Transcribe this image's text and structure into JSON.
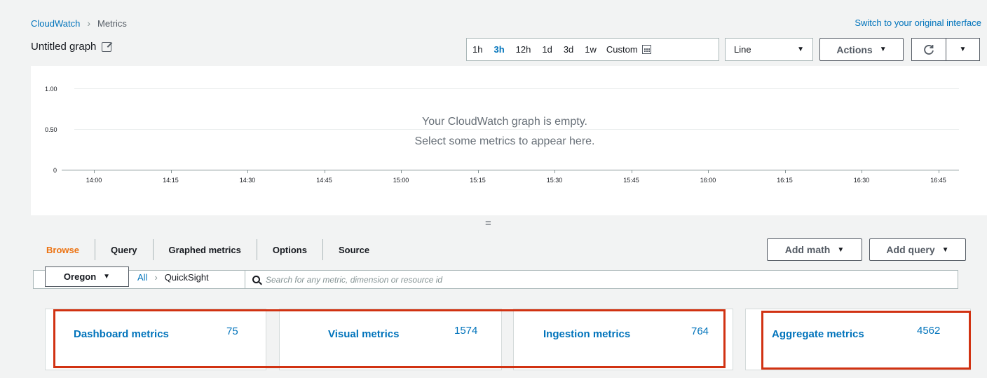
{
  "breadcrumb": {
    "root": "CloudWatch",
    "current": "Metrics"
  },
  "switch_link": "Switch to your original interface",
  "graph_title": "Untitled graph",
  "time_range": {
    "options": [
      "1h",
      "3h",
      "12h",
      "1d",
      "3d",
      "1w"
    ],
    "active": "3h",
    "custom": "Custom"
  },
  "chart_type": {
    "selected": "Line"
  },
  "actions_label": "Actions",
  "chart": {
    "y_ticks": [
      "1.00",
      "0.50",
      "0"
    ],
    "x_ticks": [
      "14:00",
      "14:15",
      "14:30",
      "14:45",
      "15:00",
      "15:15",
      "15:30",
      "15:45",
      "16:00",
      "16:15",
      "16:30",
      "16:45"
    ],
    "empty_line1": "Your CloudWatch graph is empty.",
    "empty_line2": "Select some metrics to appear here."
  },
  "resize_handle": "=",
  "tabs": [
    "Browse",
    "Query",
    "Graphed metrics",
    "Options",
    "Source"
  ],
  "active_tab": "Browse",
  "add_math_label": "Add math",
  "add_query_label": "Add query",
  "region": "Oregon",
  "browse_crumb": {
    "all": "All",
    "namespace": "QuickSight"
  },
  "search": {
    "placeholder": "Search for any metric, dimension or resource id"
  },
  "metric_cards": [
    {
      "label": "Dashboard metrics",
      "count": "75"
    },
    {
      "label": "Visual metrics",
      "count": "1574"
    },
    {
      "label": "Ingestion metrics",
      "count": "764"
    },
    {
      "label": "Aggregate metrics",
      "count": "4562"
    }
  ],
  "colors": {
    "link": "#0073bb",
    "active_tab": "#ec7211",
    "highlight": "#d13212"
  }
}
